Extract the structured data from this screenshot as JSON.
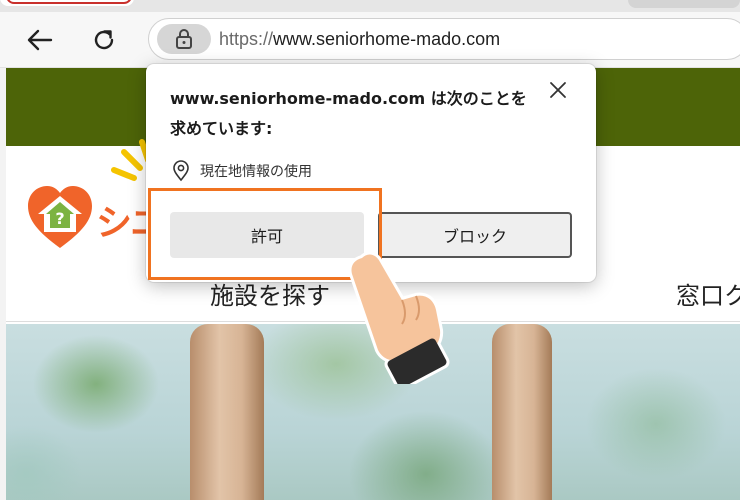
{
  "browser": {
    "url_scheme": "https://",
    "url_host": "www.seniorhome-mado.com",
    "back_icon": "arrow-left-icon",
    "refresh_icon": "refresh-icon",
    "lock_icon": "lock-icon"
  },
  "site": {
    "logo_text": "シニ",
    "nav": [
      "施設を探す",
      "窓口ク"
    ],
    "brand_colors": {
      "header_bar": "#4d6408",
      "logo": "#f0642a"
    }
  },
  "permission_popup": {
    "title": "www.seniorhome-mado.com は次のことを求めています:",
    "permission_label": "現在地情報の使用",
    "permission_icon": "location-pin-icon",
    "allow_label": "許可",
    "block_label": "ブロック",
    "close_icon": "close-icon"
  },
  "annotation": {
    "highlight_color": "#f07320",
    "pointer": "pointing-hand-icon"
  }
}
